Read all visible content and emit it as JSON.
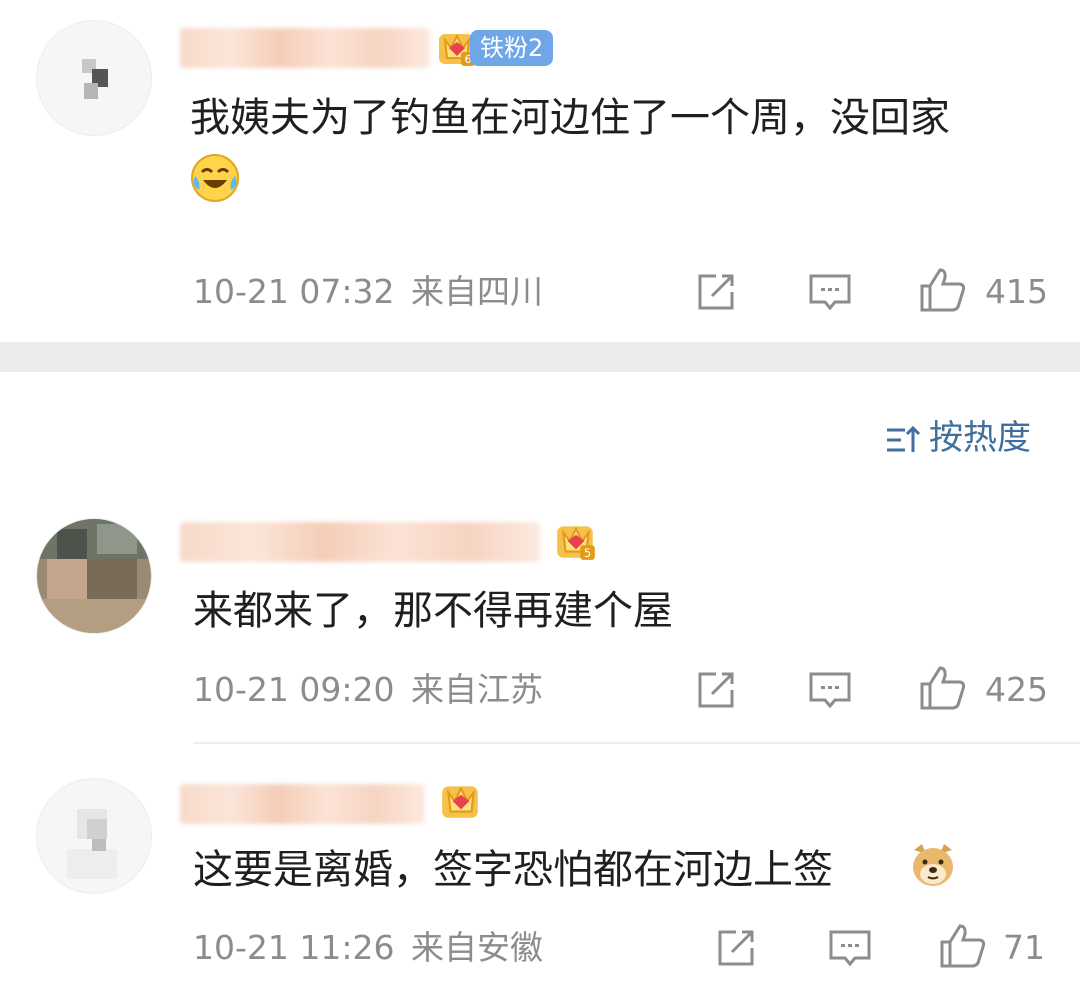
{
  "comments": [
    {
      "text_line1": "我姨夫为了钓鱼在河边住了一个周，没回家",
      "emoji": "laughing-crying-emoji",
      "badge_level": "6",
      "fan_badge": "铁粉2",
      "time": "10-21 07:32",
      "location": "来自四川",
      "likes": "415"
    },
    {
      "text_line1": "来都来了，那不得再建个屋",
      "badge_level": "5",
      "time": "10-21 09:20",
      "location": "来自江苏",
      "likes": "425"
    },
    {
      "text_line1": "这要是离婚，签字恐怕都在河边上签",
      "emoji": "doge-emoji",
      "time": "10-21 11:26",
      "location": "来自安徽",
      "likes": "71"
    }
  ],
  "sort": {
    "label": "按热度"
  },
  "colors": {
    "accent": "#3f6f9c",
    "fan_badge": "#6fa6e8",
    "meta": "#8c8c8c",
    "divider": "#ececec"
  }
}
